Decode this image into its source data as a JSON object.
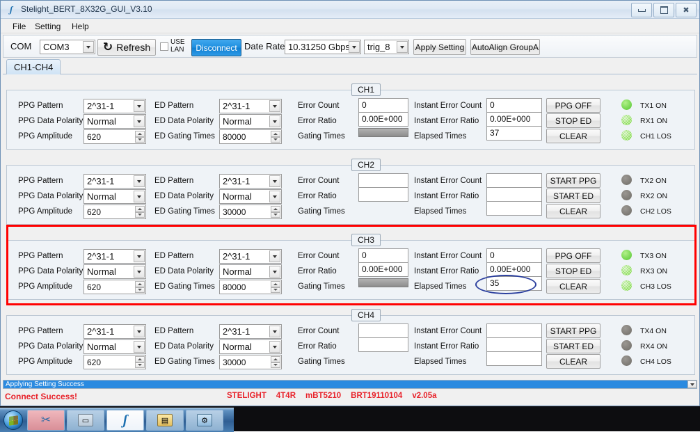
{
  "window": {
    "title": "Stelight_BERT_8X32G_GUI_V3.10",
    "app_icon": "stelight-logo-icon",
    "minimize": "minimize-icon",
    "maximize": "maximize-icon",
    "close": "close-icon"
  },
  "menu": [
    "File",
    "Setting",
    "Help"
  ],
  "toolbar": {
    "com_label": "COM",
    "com_value": "COM3",
    "refresh_label": "Refresh",
    "use_lan_line1": "USE",
    "use_lan_line2": "LAN",
    "use_lan_checked": false,
    "disconnect_label": "Disconnect",
    "date_rate_label": "Date Rate",
    "date_rate_value": "10.31250 Gbps",
    "trig_value": "trig_8",
    "apply_label": "Apply Setting",
    "autoalign_label": "AutoAlign GroupA"
  },
  "tabs": [
    {
      "label": "CH1-CH4",
      "active": true
    }
  ],
  "labels": {
    "ppg_pattern": "PPG Pattern",
    "ppg_polarity": "PPG Data Polarity",
    "ppg_amplitude": "PPG Amplitude",
    "ed_pattern": "ED Pattern",
    "ed_polarity": "ED Data Polarity",
    "ed_gating": "ED Gating Times",
    "error_count": "Error Count",
    "error_ratio": "Error Ratio",
    "gating_times": "Gating Times",
    "inst_error_count": "Instant Error Count",
    "inst_error_ratio": "Instant Error Ratio",
    "elapsed_times": "Elapsed Times"
  },
  "channels": [
    {
      "id": "CH1",
      "title": "CH1",
      "ppg_pattern": "2^31-1",
      "ppg_polarity": "Normal",
      "ppg_amplitude": "620",
      "ed_pattern": "2^31-1",
      "ed_polarity": "Normal",
      "ed_gating": "80000",
      "error_count": "0",
      "error_ratio": "0.00E+000",
      "gating_bar": true,
      "inst_error_count": "0",
      "inst_error_ratio": "0.00E+000",
      "elapsed_times": "37",
      "btn_ppg": "PPG OFF",
      "btn_ed": "STOP ED",
      "btn_clear": "CLEAR",
      "led_tx": {
        "label": "TX1 ON",
        "state": "on"
      },
      "led_rx": {
        "label": "RX1 ON",
        "state": "on-dim"
      },
      "led_los": {
        "label": "CH1 LOS",
        "state": "on-dim"
      },
      "highlight": false
    },
    {
      "id": "CH2",
      "title": "CH2",
      "ppg_pattern": "2^31-1",
      "ppg_polarity": "Normal",
      "ppg_amplitude": "620",
      "ed_pattern": "2^31-1",
      "ed_polarity": "Normal",
      "ed_gating": "30000",
      "error_count": "",
      "error_ratio": "",
      "gating_bar": false,
      "inst_error_count": "",
      "inst_error_ratio": "",
      "elapsed_times": "",
      "btn_ppg": "START PPG",
      "btn_ed": "START ED",
      "btn_clear": "CLEAR",
      "led_tx": {
        "label": "TX2 ON",
        "state": "off"
      },
      "led_rx": {
        "label": "RX2 ON",
        "state": "off"
      },
      "led_los": {
        "label": "CH2 LOS",
        "state": "off"
      },
      "highlight": false
    },
    {
      "id": "CH3",
      "title": "CH3",
      "ppg_pattern": "2^31-1",
      "ppg_polarity": "Normal",
      "ppg_amplitude": "620",
      "ed_pattern": "2^31-1",
      "ed_polarity": "Normal",
      "ed_gating": "80000",
      "error_count": "0",
      "error_ratio": "0.00E+000",
      "gating_bar": true,
      "inst_error_count": "0",
      "inst_error_ratio": "0.00E+000",
      "elapsed_times": "35",
      "btn_ppg": "PPG OFF",
      "btn_ed": "STOP ED",
      "btn_clear": "CLEAR",
      "led_tx": {
        "label": "TX3 ON",
        "state": "on"
      },
      "led_rx": {
        "label": "RX3 ON",
        "state": "on-dim"
      },
      "led_los": {
        "label": "CH3 LOS",
        "state": "on-dim"
      },
      "highlight": true
    },
    {
      "id": "CH4",
      "title": "CH4",
      "ppg_pattern": "2^31-1",
      "ppg_polarity": "Normal",
      "ppg_amplitude": "620",
      "ed_pattern": "2^31-1",
      "ed_polarity": "Normal",
      "ed_gating": "30000",
      "error_count": "",
      "error_ratio": "",
      "gating_bar": false,
      "inst_error_count": "",
      "inst_error_ratio": "",
      "elapsed_times": "",
      "btn_ppg": "START PPG",
      "btn_ed": "START ED",
      "btn_clear": "CLEAR",
      "led_tx": {
        "label": "TX4 ON",
        "state": "off"
      },
      "led_rx": {
        "label": "RX4 ON",
        "state": "off"
      },
      "led_los": {
        "label": "CH4 LOS",
        "state": "off"
      },
      "highlight": false
    }
  ],
  "status": {
    "progress_text": "Applying Setting Success",
    "connect_text": "Connect Success!",
    "info": [
      "STELIGHT",
      "4T4R",
      "mBT5210",
      "BRT19110104",
      "v2.05a"
    ]
  },
  "annotations": {
    "red_box_target": "CH3",
    "blue_ellipse_target": "CH3 Elapsed Times"
  },
  "taskbar": {
    "start": "windows-start-orb-icon",
    "items": [
      {
        "name": "snipping-tool-icon",
        "glyph": "✂"
      },
      {
        "name": "display-monitor-icon",
        "glyph": "🖥"
      },
      {
        "name": "stelight-bert-gui-icon",
        "glyph": "S"
      },
      {
        "name": "calculator-icon",
        "glyph": "🖭"
      },
      {
        "name": "control-panel-icon",
        "glyph": "⚙"
      }
    ]
  },
  "colors": {
    "accent_blue": "#2a8ae0",
    "highlight_red": "#ff0000",
    "annotation_blue": "#2b3f9e",
    "led_on": "#6fd34a",
    "led_off": "#7c7974",
    "status_red_text": "#e8222a"
  }
}
